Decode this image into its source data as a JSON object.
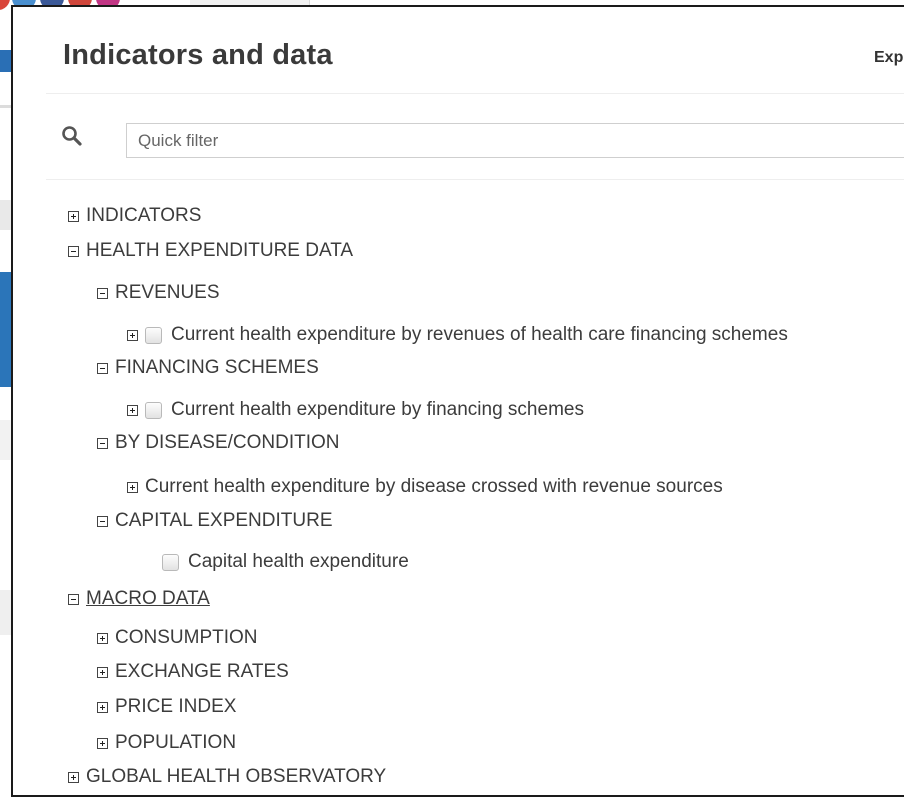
{
  "dialog": {
    "title": "Indicators and data",
    "export_label": "Exp"
  },
  "search": {
    "placeholder": "Quick filter",
    "value": ""
  },
  "tree": {
    "indicators": "INDICATORS",
    "health_expenditure": "HEALTH EXPENDITURE DATA",
    "revenues": "REVENUES",
    "revenues_child": "Current health expenditure by revenues of health care financing schemes",
    "financing_schemes": "FINANCING SCHEMES",
    "financing_child": "Current health expenditure by financing schemes",
    "by_disease": "BY DISEASE/CONDITION",
    "disease_child": "Current health expenditure by disease crossed with revenue sources",
    "capital_expenditure": "CAPITAL EXPENDITURE",
    "capital_child": "Capital health expenditure",
    "macro_data": "MACRO DATA",
    "consumption": "CONSUMPTION",
    "exchange_rates": "EXCHANGE RATES",
    "price_index": "PRICE INDEX",
    "population": "POPULATION",
    "gho": "GLOBAL HEALTH OBSERVATORY"
  },
  "colors": {
    "title": "#3a3a3a",
    "modal_border": "#1a1a1a",
    "tree_text": "#3c3c3c"
  }
}
